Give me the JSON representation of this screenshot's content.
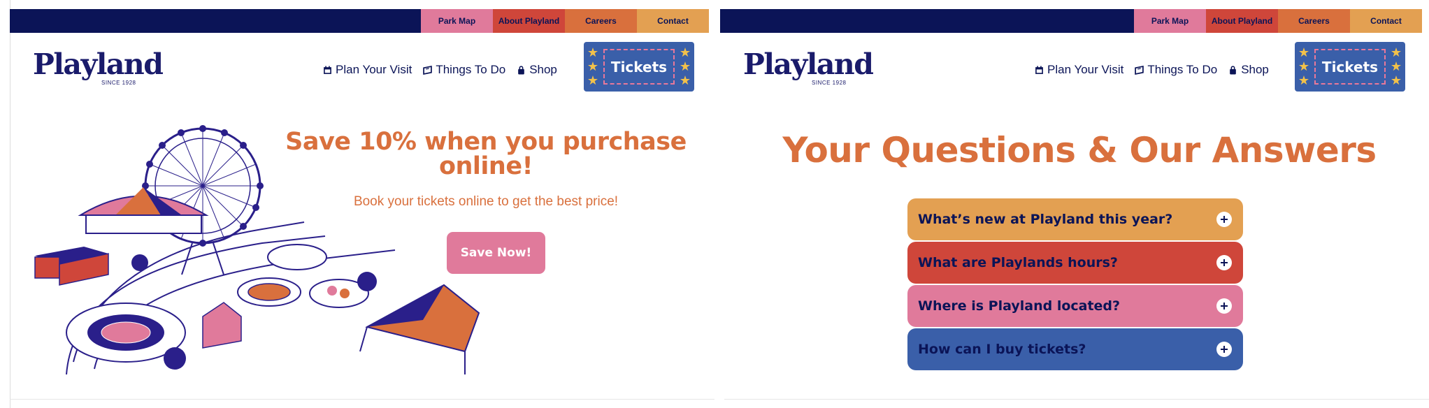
{
  "colors": {
    "navy": "#0b1457",
    "orange": "#d9703d",
    "pink": "#e07a9b",
    "red": "#cf463a",
    "amber": "#e3a052",
    "blue": "#3a5fa9"
  },
  "left": {
    "topnav": [
      {
        "label": "Park Map",
        "color": "#e07a9b"
      },
      {
        "label": "About Playland",
        "color": "#cf463a"
      },
      {
        "label": "Careers",
        "color": "#d9703d"
      },
      {
        "label": "Contact",
        "color": "#e3a052"
      }
    ],
    "logo": {
      "name": "Playland",
      "tagline": "SINCE 1928"
    },
    "mainnav": [
      {
        "label": "Plan Your Visit",
        "icon": "calendar-icon"
      },
      {
        "label": "Things To Do",
        "icon": "ticket-icon"
      },
      {
        "label": "Shop",
        "icon": "bag-icon"
      }
    ],
    "tickets_label": "Tickets",
    "promo": {
      "title": "Save 10% when you purchase online!",
      "subtitle": "Book your tickets online to get the best price!",
      "button": "Save Now!"
    }
  },
  "right": {
    "topnav": [
      {
        "label": "Park Map",
        "color": "#e07a9b"
      },
      {
        "label": "About Playland",
        "color": "#cf463a"
      },
      {
        "label": "Careers",
        "color": "#d9703d"
      },
      {
        "label": "Contact",
        "color": "#e3a052"
      }
    ],
    "logo": {
      "name": "Playland",
      "tagline": "SINCE 1928"
    },
    "mainnav": [
      {
        "label": "Plan Your Visit",
        "icon": "calendar-icon"
      },
      {
        "label": "Things To Do",
        "icon": "ticket-icon"
      },
      {
        "label": "Shop",
        "icon": "bag-icon"
      }
    ],
    "tickets_label": "Tickets",
    "faq": {
      "title": "Your Questions & Our Answers",
      "items": [
        {
          "question": "What’s new at Playland this year?",
          "color": "#e3a052"
        },
        {
          "question": "What are Playlands hours?",
          "color": "#cf463a"
        },
        {
          "question": "Where is Playland located?",
          "color": "#e07a9b"
        },
        {
          "question": "How can I buy tickets?",
          "color": "#3a5fa9"
        }
      ]
    }
  }
}
